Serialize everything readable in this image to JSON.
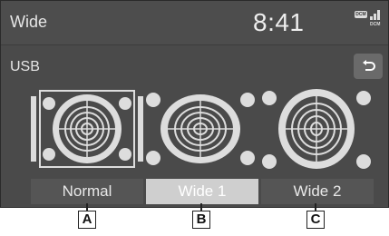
{
  "title_bar": {
    "title": "Wide",
    "clock": "8:41",
    "status_badge": "DCM",
    "status_text": "DCM"
  },
  "source": {
    "label": "USB"
  },
  "back_button": {
    "icon": "back-arrow-icon"
  },
  "modes": [
    {
      "label": "Normal",
      "selected": false
    },
    {
      "label": "Wide 1",
      "selected": true
    },
    {
      "label": "Wide 2",
      "selected": false
    }
  ],
  "callouts": [
    "A",
    "B",
    "C"
  ],
  "colors": {
    "background": "#4a4a4a",
    "selected": "#cfcfcf",
    "button": "#555555"
  }
}
